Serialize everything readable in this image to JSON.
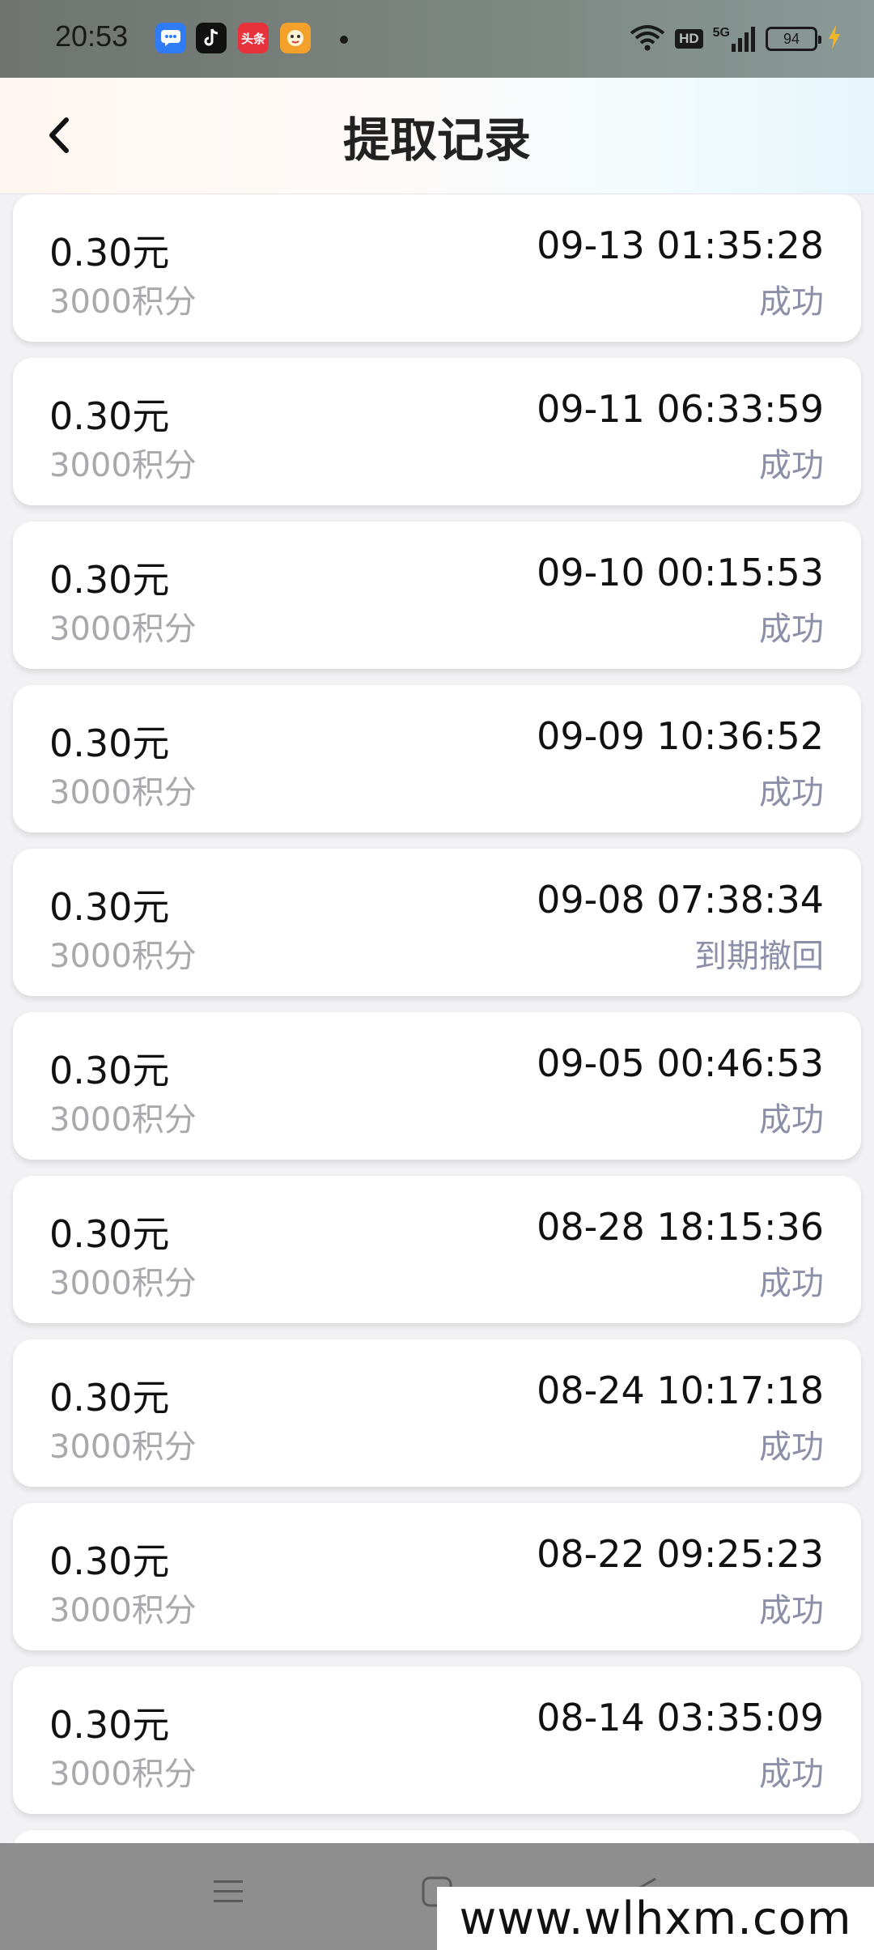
{
  "status_bar": {
    "time": "20:53",
    "network": "5G",
    "hd_label": "HD",
    "battery": "94",
    "app_icons": [
      "message-icon",
      "tiktok-icon",
      "toutiao-icon",
      "game-icon"
    ],
    "toutiao_label": "头条"
  },
  "header": {
    "title": "提取记录",
    "back_icon": "chevron-left-icon"
  },
  "records": [
    {
      "amount": "0.30元",
      "points": "3000积分",
      "time": "09-13 01:35:28",
      "status": "成功"
    },
    {
      "amount": "0.30元",
      "points": "3000积分",
      "time": "09-11 06:33:59",
      "status": "成功"
    },
    {
      "amount": "0.30元",
      "points": "3000积分",
      "time": "09-10 00:15:53",
      "status": "成功"
    },
    {
      "amount": "0.30元",
      "points": "3000积分",
      "time": "09-09 10:36:52",
      "status": "成功"
    },
    {
      "amount": "0.30元",
      "points": "3000积分",
      "time": "09-08 07:38:34",
      "status": "到期撤回"
    },
    {
      "amount": "0.30元",
      "points": "3000积分",
      "time": "09-05 00:46:53",
      "status": "成功"
    },
    {
      "amount": "0.30元",
      "points": "3000积分",
      "time": "08-28 18:15:36",
      "status": "成功"
    },
    {
      "amount": "0.30元",
      "points": "3000积分",
      "time": "08-24 10:17:18",
      "status": "成功"
    },
    {
      "amount": "0.30元",
      "points": "3000积分",
      "time": "08-22 09:25:23",
      "status": "成功"
    },
    {
      "amount": "0.30元",
      "points": "3000积分",
      "time": "08-14 03:35:09",
      "status": "成功"
    }
  ],
  "nav_bar": {
    "icons": [
      "menu-icon",
      "home-icon",
      "back-triangle-icon"
    ]
  },
  "watermark": "www.wlhxm.com",
  "colors": {
    "status_text": "#8c8fa8",
    "points_text": "#a9a9ad",
    "background": "#f2f2f4"
  }
}
